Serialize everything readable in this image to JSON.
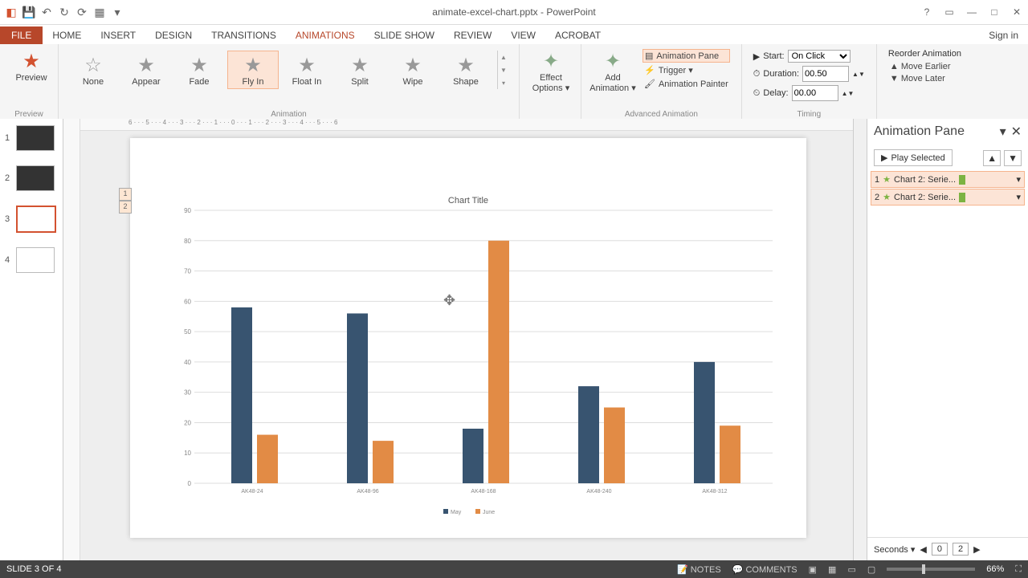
{
  "titlebar": {
    "title": "animate-excel-chart.pptx - PowerPoint"
  },
  "tabs": {
    "file": "FILE",
    "home": "HOME",
    "insert": "INSERT",
    "design": "DESIGN",
    "transitions": "TRANSITIONS",
    "animations": "ANIMATIONS",
    "slideshow": "SLIDE SHOW",
    "review": "REVIEW",
    "view": "VIEW",
    "acrobat": "ACROBAT",
    "signin": "Sign in"
  },
  "ribbon": {
    "preview": {
      "label": "Preview",
      "group": "Preview"
    },
    "gallery": {
      "group": "Animation",
      "items": [
        "None",
        "Appear",
        "Fade",
        "Fly In",
        "Float In",
        "Split",
        "Wipe",
        "Shape"
      ],
      "selected": "Fly In"
    },
    "effect_options": "Effect Options ▾",
    "add_anim": "Add Animation ▾",
    "adv": {
      "group": "Advanced Animation",
      "pane": "Animation Pane",
      "trigger": "Trigger ▾",
      "painter": "Animation Painter"
    },
    "timing": {
      "group": "Timing",
      "start_label": "Start:",
      "start_value": "On Click",
      "duration_label": "Duration:",
      "duration_value": "00.50",
      "delay_label": "Delay:",
      "delay_value": "00.00"
    },
    "reorder": {
      "title": "Reorder Animation",
      "earlier": "▲ Move Earlier",
      "later": "▼ Move Later"
    }
  },
  "thumbs": [
    {
      "n": "1"
    },
    {
      "n": "2"
    },
    {
      "n": "3"
    },
    {
      "n": "4"
    }
  ],
  "slide": {
    "tags": [
      "1",
      "2"
    ],
    "chart_title": "Chart Title"
  },
  "chart_data": {
    "type": "bar",
    "title": "Chart Title",
    "categories": [
      "AK48-24",
      "AK48-96",
      "AK48-168",
      "AK48-240",
      "AK48-312"
    ],
    "series": [
      {
        "name": "May",
        "color": "#385470",
        "values": [
          58,
          56,
          18,
          32,
          40
        ]
      },
      {
        "name": "June",
        "color": "#e28b45",
        "values": [
          16,
          14,
          80,
          25,
          19
        ]
      }
    ],
    "ylabel": "",
    "xlabel": "",
    "ylim": [
      0,
      90
    ],
    "yticks": [
      0,
      10,
      20,
      30,
      40,
      50,
      60,
      70,
      80,
      90
    ],
    "legend": [
      "May",
      "June"
    ]
  },
  "anim_pane": {
    "title": "Animation Pane",
    "play": "Play Selected",
    "items": [
      {
        "n": "1",
        "label": "Chart 2: Serie..."
      },
      {
        "n": "2",
        "label": "Chart 2: Serie..."
      }
    ],
    "seconds": "Seconds ▾",
    "t0": "0",
    "t1": "2"
  },
  "status": {
    "slide": "SLIDE 3 OF 4",
    "notes": "NOTES",
    "comments": "COMMENTS",
    "zoom": "66%"
  }
}
